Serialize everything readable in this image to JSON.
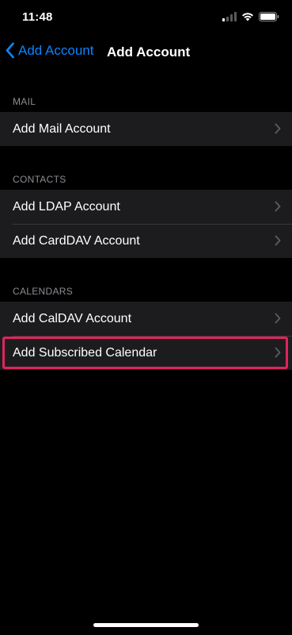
{
  "status_bar": {
    "time": "11:48",
    "icons": [
      "cellular-signal-icon",
      "wifi-icon",
      "battery-icon"
    ]
  },
  "nav": {
    "back_label": "Add Account",
    "title": "Add Account"
  },
  "sections": {
    "mail": {
      "header": "MAIL",
      "items": [
        "Add Mail Account"
      ]
    },
    "contacts": {
      "header": "CONTACTS",
      "items": [
        "Add LDAP Account",
        "Add CardDAV Account"
      ]
    },
    "calendars": {
      "header": "CALENDARS",
      "items": [
        "Add CalDAV Account",
        "Add Subscribed Calendar"
      ]
    }
  },
  "colors": {
    "background": "#000000",
    "cell": "#1c1c1e",
    "accent": "#0a84ff",
    "highlight": "#e0245e",
    "secondary_text": "#8d8d93"
  }
}
